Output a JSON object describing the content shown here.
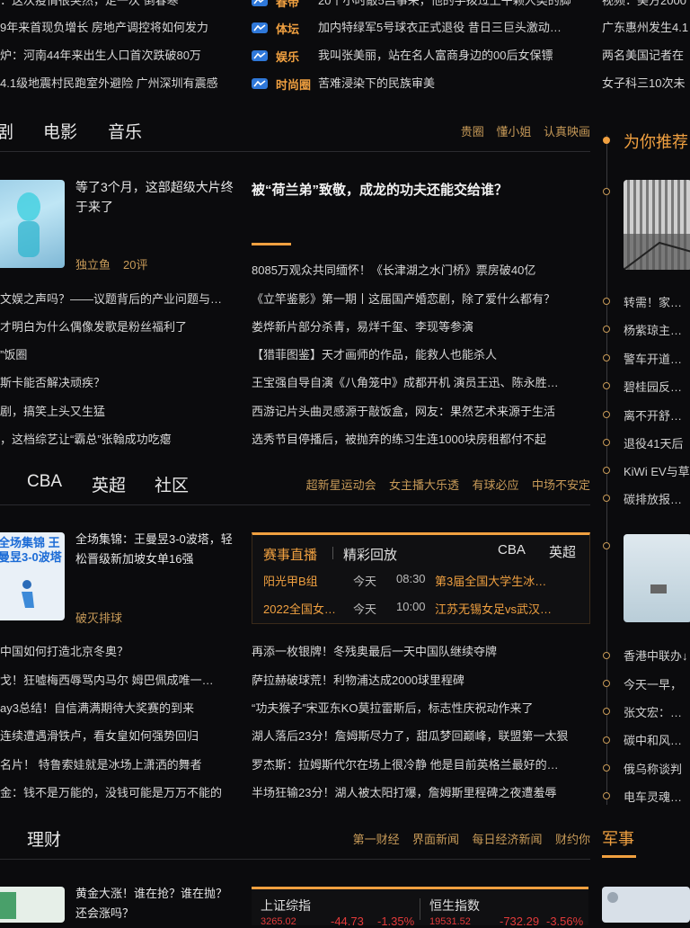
{
  "top_news": {
    "left_col": [
      "9年来首现负增长 房地产调控将如何发力",
      "炉：河南44年来出生人口首次跌破80万",
      "4.1级地震村民跑室外避险 广州深圳有震感"
    ],
    "left_top_partial": "：这次疫情很突然，走一次 倒春寒",
    "mid_rows": [
      {
        "tag": "体坛",
        "text": "加内特绿军5号球衣正式退役 昔日三巨头激动…"
      },
      {
        "tag": "娱乐",
        "text": "我叫张美丽，站在名人富商身边的00后女保镖"
      },
      {
        "tag": "时尚圈",
        "text": "苦难浸染下的民族审美"
      }
    ],
    "mid_top_partial": {
      "tag": "春帝",
      "text": "20个小时敲5吕事来，他的手拨过上午颗人类的脚"
    },
    "right_col": [
      "广东惠州发生4.1",
      "两名美国记者在",
      "女子科三10次未"
    ],
    "right_top_partial": "视频：美方2000"
  },
  "ent_section": {
    "tabs": [
      "剧",
      "电影",
      "音乐"
    ],
    "links": [
      "贵圈",
      "懂小姐",
      "认真映画"
    ],
    "feature": {
      "title": "等了3个月，这部超级大片终于来了",
      "source": "独立鱼",
      "comments": "20评"
    },
    "headline": "被“荷兰弟”致敬，成龙的功夫还能交给谁？",
    "left_list": [
      "文娱之声吗？——议题背后的产业问题与…",
      "才明白为什么偶像发歌是粉丝福利了",
      "饭圈",
      "斯卡能否解决顽疾？",
      "剧，搞笑上头又生猛",
      "，这档综艺让“霸总”张翰成功吃瘪"
    ],
    "left_list_prefix": "”",
    "right_list": [
      "8085万观众共同缅怀！《长津湖之水门桥》票房破40亿",
      "《立竿鉴影》第一期丨这届国产婚恋剧，除了爱什么都有？",
      "娄烨新片部分杀青，易烊千玺、李现等参演",
      "【猎菲图鉴】天才画师的作品，能救人也能杀人",
      "王宝强自导自演《八角笼中》成都开机 演员王迅、陈永胜…",
      "西游记片头曲灵感源于敲饭盒，网友：果然艺术来源于生活",
      "选秀节目停播后，被抛弃的练习生连1000块房租都付不起"
    ]
  },
  "sports_section": {
    "tabs": [
      "CBA",
      "英超",
      "社区"
    ],
    "links": [
      "超新星运动会",
      "女主播大乐透",
      "有球必应",
      "中场不安定"
    ],
    "feature": {
      "title": "全场集锦：王曼昱3-0波塔，轻松晋级新加坡女单16强",
      "source": "破灭排球",
      "thumb_text": "全场集锦 王曼昱3-0波塔"
    },
    "live_box": {
      "tabs": [
        "赛事直播",
        "精彩回放"
      ],
      "right_tabs": [
        "CBA",
        "英超"
      ],
      "rows": [
        {
          "league": "阳光甲B组",
          "day": "今天",
          "time": "08:30",
          "match": "第3届全国大学生冰…"
        },
        {
          "league": "2022全国女…",
          "day": "今天",
          "time": "10:00",
          "match": "江苏无锡女足vs武汉…"
        }
      ]
    },
    "left_list": [
      "中国如何打造北京冬奥？",
      "戈！狂嘘梅西辱骂内马尔 姆巴佩成唯一…",
      "ay3总结！自信满满期待大奖赛的到来",
      "连续遭遇滑铁卢，看女皇如何强势回归",
      "名片！ 特鲁索娃就是冰场上潇洒的舞者",
      "金：钱不是万能的，没钱可能是万万不能的"
    ],
    "right_list": [
      "再添一枚银牌！冬残奥最后一天中国队继续夺牌",
      "萨拉赫破球荒！利物浦达成2000球里程碑",
      "“功夫猴子”宋亚东KO莫拉雷斯后，标志性庆祝动作来了",
      "湖人落后23分！詹姆斯尽力了，甜瓜梦回巅峰，联盟第一太狠",
      "罗杰斯：拉姆斯代尔在场上很冷静 他是目前英格兰最好的…",
      "半场狂输23分！湖人被太阳打爆，詹姆斯里程碑之夜遭羞辱"
    ]
  },
  "finance_section": {
    "tab": "理财",
    "links": [
      "第一财经",
      "界面新闻",
      "每日经济新闻",
      "财约你"
    ],
    "feature": {
      "title": "黄金大涨！谁在抢？谁在抛？还会涨吗？"
    },
    "stocks": [
      {
        "name": "上证综指",
        "value": "3265.02",
        "change": "-44.73",
        "pct": "-1.35%"
      },
      {
        "name": "恒生指数",
        "value": "19531.52",
        "change": "-732.29",
        "pct": "-3.56%"
      }
    ]
  },
  "recommend": {
    "title": "为你推荐",
    "items": [
      "转需！家庭防",
      "杨紫琼主演电",
      "警车开道！深",
      "碧桂园反击恶",
      "离不开舒适圈",
      "退役41天后",
      "KiWi EV与草",
      "碳排放报告数"
    ],
    "items2": [
      "香港中联办↓",
      "今天一早，",
      "张文宏：对于",
      "碳中和风口下",
      "俄乌称谈判",
      "电车灵魂五问"
    ]
  },
  "military": {
    "title": "军事"
  },
  "colors": {
    "accent": "#f0a040",
    "link": "#c79a58",
    "background": "#0b0b0d",
    "tag_blue": "#2f78d9",
    "stock_red": "#e23a3a"
  }
}
